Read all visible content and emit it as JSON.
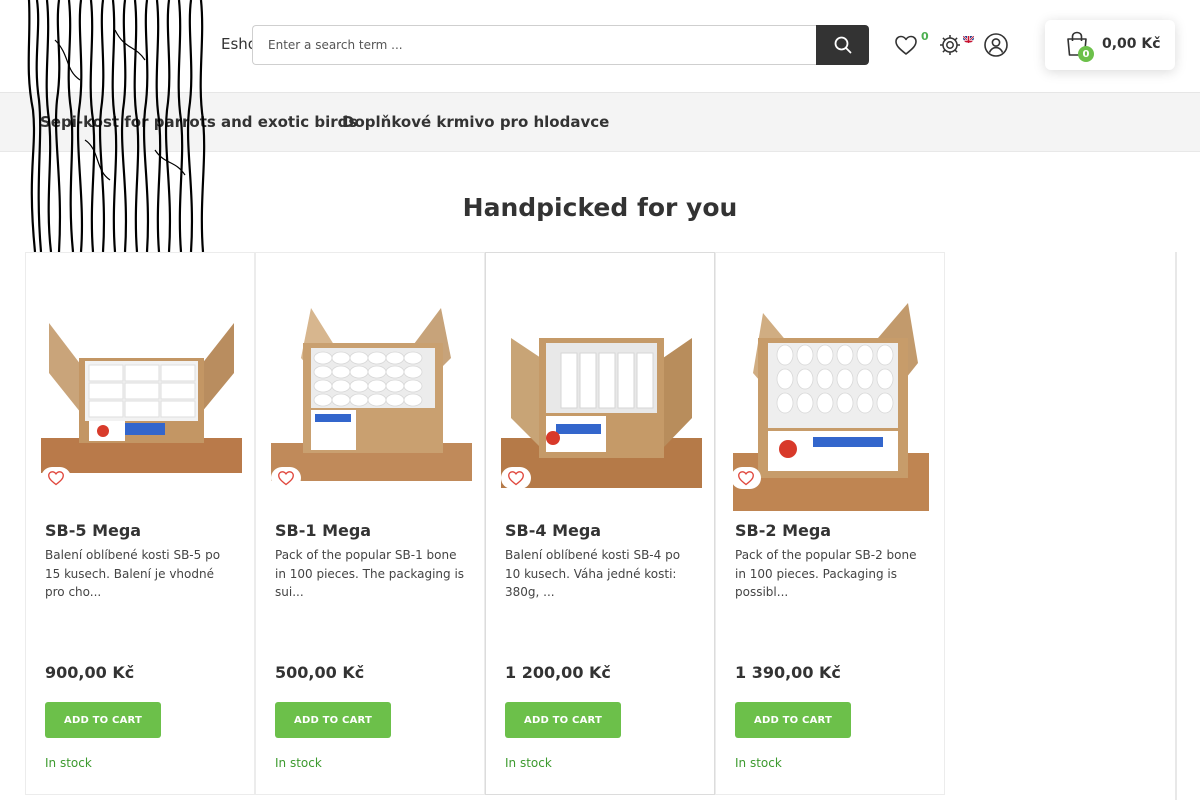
{
  "header": {
    "eshop_label": "Esho",
    "search": {
      "placeholder": "Enter a search term ..."
    },
    "wishlist_count": "0",
    "cart": {
      "count": "0",
      "total": "0,00 Kč"
    }
  },
  "nav": {
    "items": [
      {
        "label": "Sepi-kost for parrots and exotic birds"
      },
      {
        "label": "Doplňkové krmivo pro hlodavce"
      }
    ]
  },
  "section": {
    "title": "Handpicked for you"
  },
  "products": [
    {
      "name": "SB-5 Mega",
      "description": "Balení oblíbené kosti SB-5 po 15 kusech. Balení je vhodné pro cho...",
      "price": "900,00 Kč",
      "add_label": "ADD TO CART",
      "stock": "In stock"
    },
    {
      "name": "SB-1 Mega",
      "description": "Pack of the popular SB-1 bone in 100 pieces. The packaging is sui...",
      "price": "500,00 Kč",
      "add_label": "ADD TO CART",
      "stock": "In stock"
    },
    {
      "name": "SB-4 Mega",
      "description": "Balení oblíbené kosti SB-4 po 10 kusech. Váha jedné kosti: 380g, ...",
      "price": "1 200,00 Kč",
      "add_label": "ADD TO CART",
      "stock": "In stock"
    },
    {
      "name": "SB-2 Mega",
      "description": "Pack of the popular SB-2 bone in 100 pieces. Packaging is possibl...",
      "price": "1 390,00 Kč",
      "add_label": "ADD TO CART",
      "stock": "In stock"
    }
  ],
  "colors": {
    "accent_green": "#6cc04a",
    "stock_green": "#3c9a2e",
    "search_button": "#333333",
    "nav_background": "#f4f4f4"
  },
  "icons": {
    "search": "search-icon",
    "wishlist": "heart-icon",
    "settings": "gear-icon",
    "language": "uk-flag-icon",
    "account": "user-icon",
    "cart": "shopping-bag-icon",
    "product_wishlist": "heart-outline-icon"
  }
}
